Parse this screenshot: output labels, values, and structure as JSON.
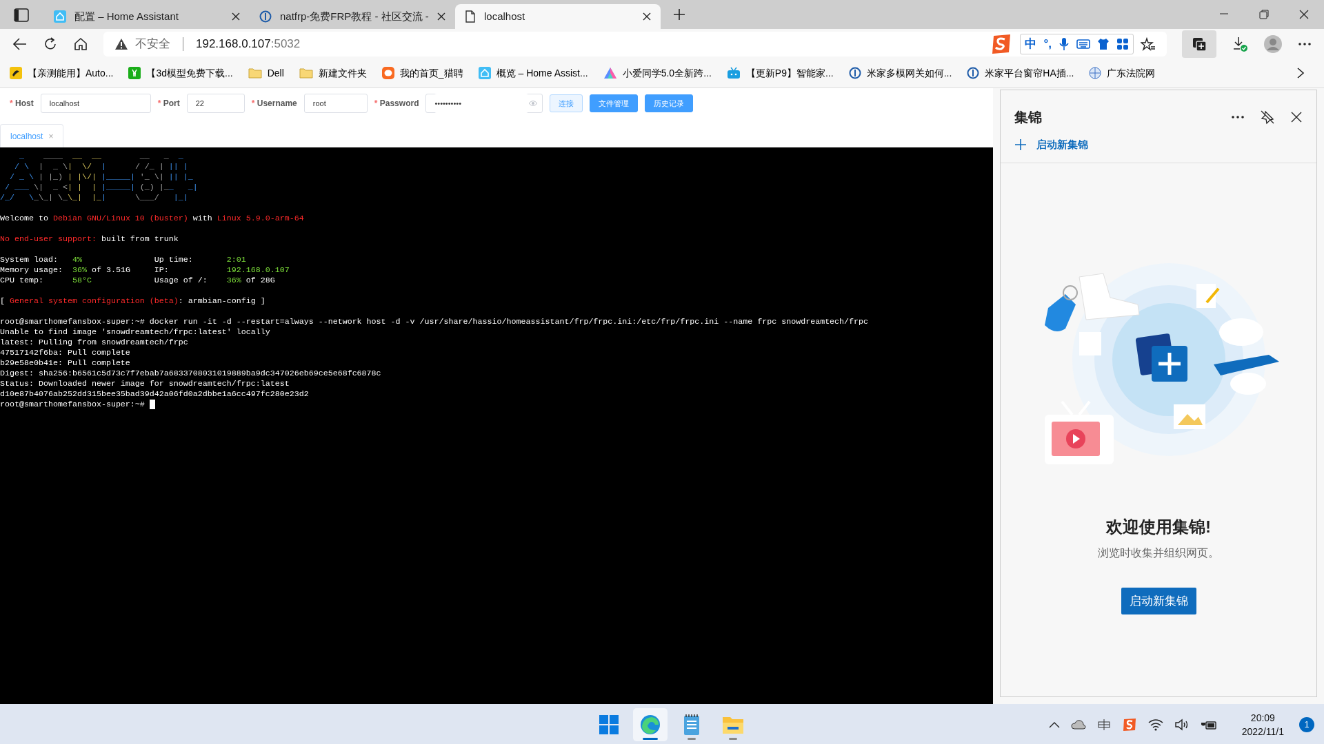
{
  "browser": {
    "tabs": [
      {
        "title": "配置 – Home Assistant",
        "selected": false
      },
      {
        "title": "natfrp-免费FRP教程 - 社区交流 -",
        "selected": false
      },
      {
        "title": "localhost",
        "selected": true
      }
    ],
    "address": {
      "security": "不安全",
      "host": "192.168.0.107",
      "port": ":5032"
    },
    "ime": [
      "中",
      "°,"
    ],
    "bookmarks": [
      {
        "title": "【亲测能用】Auto..."
      },
      {
        "title": "【3d模型免费下载..."
      },
      {
        "title": "Dell"
      },
      {
        "title": "新建文件夹"
      },
      {
        "title": "我的首页_猎聘"
      },
      {
        "title": "概览 – Home Assist..."
      },
      {
        "title": "小爱同学5.0全新跨..."
      },
      {
        "title": "【更新P9】智能家..."
      },
      {
        "title": "米家多模网关如何..."
      },
      {
        "title": "米家平台窗帘HA插..."
      },
      {
        "title": "广东法院网"
      }
    ]
  },
  "form": {
    "required_mark": "*",
    "fields": [
      {
        "label": "Host",
        "value": "localhost",
        "required": true
      },
      {
        "label": "Port",
        "value": "22",
        "required": true
      },
      {
        "label": "Username",
        "value": "root",
        "required": true
      },
      {
        "label": "Password",
        "value": "••••••••••",
        "required": true
      }
    ],
    "buttons": [
      {
        "label": "连接",
        "kind": "plain"
      },
      {
        "label": "文件管理",
        "kind": "primary"
      },
      {
        "label": "历史记录",
        "kind": "primary"
      }
    ],
    "session_tabs": [
      {
        "label": "localhost",
        "close": "×",
        "selected": true
      }
    ]
  },
  "terminal": {
    "banner": [
      "    _    ____  __  __        __   _  _   ",
      "   / \\  |  _ \\|  \\/  |      / /_ | || |  ",
      "  / _ \\ | |_) | |\\/| |_____| '_ \\| || |_ ",
      " / ___ \\|  _ <| |  | |_____| (_) |__   _|",
      "/_/   \\_\\_| \\_\\_|  |_|      \\___/   |_|  "
    ],
    "blocks": [
      [
        [
          {
            "text": "Welcome to "
          },
          {
            "text": "Debian GNU/Linux 10 (buster)",
            "color": "#ff2a2a"
          },
          {
            "text": " with "
          },
          {
            "text": "Linux 5.9.0-arm-64",
            "color": "#ff2a2a"
          }
        ]
      ],
      [
        [
          {
            "text": "No end-user support:",
            "color": "#ff2a2a"
          },
          {
            "text": " built from trunk"
          }
        ]
      ],
      [
        [
          {
            "text": "System load:   "
          },
          {
            "text": "4%",
            "color": "#7ee03a"
          },
          {
            "text": "               Up time:       "
          },
          {
            "text": "2:01",
            "color": "#7ee03a"
          }
        ],
        [
          {
            "text": "Memory usage:  "
          },
          {
            "text": "36%",
            "color": "#7ee03a"
          },
          {
            "text": " of 3.51G     IP:            "
          },
          {
            "text": "192.168.0.107",
            "color": "#7ee03a"
          }
        ],
        [
          {
            "text": "CPU temp:      "
          },
          {
            "text": "58°C",
            "color": "#7ee03a"
          },
          {
            "text": "             Usage of /:    "
          },
          {
            "text": "36%",
            "color": "#7ee03a"
          },
          {
            "text": " of 28G"
          }
        ]
      ],
      [
        [
          {
            "text": "[ "
          },
          {
            "text": "General system configuration (beta)",
            "color": "#ff2a2a"
          },
          {
            "text": ": armbian-config ]"
          }
        ]
      ],
      [
        [
          {
            "text": "root@smarthomefansbox-super:~# docker run -it -d --restart=always --network host -d -v /usr/share/hassio/homeassistant/frp/frpc.ini:/etc/frp/frpc.ini --name frpc snowdreamtech/frpc"
          }
        ],
        [
          {
            "text": "Unable to find image 'snowdreamtech/frpc:latest' locally"
          }
        ],
        [
          {
            "text": "latest: Pulling from snowdreamtech/frpc"
          }
        ],
        [
          {
            "text": "47517142f6ba: Pull complete"
          }
        ],
        [
          {
            "text": "b29e58e0b41e: Pull complete"
          }
        ],
        [
          {
            "text": "Digest: sha256:b6561c5d73c7f7ebab7a6833708031019889ba9dc347026eb69ce5e68fc6878c"
          }
        ],
        [
          {
            "text": "Status: Downloaded newer image for snowdreamtech/frpc:latest"
          }
        ],
        [
          {
            "text": "d10e87b4076ab252dd315bee35bad39d42a06fd0a2dbbe1a6cc497fc280e23d2"
          }
        ],
        [
          {
            "text": "root@smarthomefansbox-super:~# "
          }
        ]
      ]
    ]
  },
  "collections": {
    "title": "集锦",
    "new_link": "启动新集锦",
    "heading": "欢迎使用集锦!",
    "subtitle": "浏览时收集并组织网页。",
    "button": "启动新集锦"
  },
  "taskbar": {
    "apps": [
      {
        "running": false,
        "selected": false
      },
      {
        "running": true,
        "selected": true
      },
      {
        "running": true,
        "selected": false
      },
      {
        "running": true,
        "selected": false
      }
    ],
    "time": "20:09",
    "date": "2022/11/1",
    "notifications": "1"
  }
}
